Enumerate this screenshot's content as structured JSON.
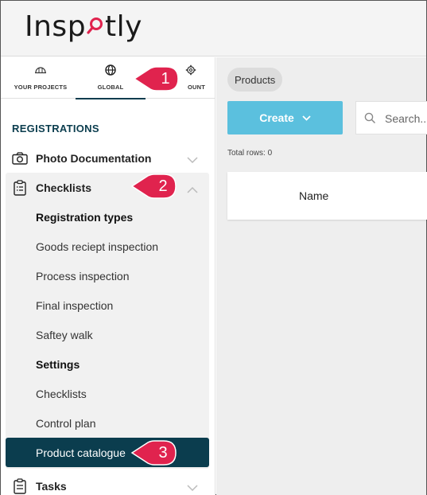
{
  "app": {
    "logo_text_left": "Insp",
    "logo_text_right": "tly",
    "brand_color": "#e0234e"
  },
  "sidebar": {
    "tabs": [
      {
        "label": "YOUR PROJECTS",
        "icon": "hard-hat-icon"
      },
      {
        "label": "GLOBAL",
        "icon": "globe-icon",
        "active": true
      },
      {
        "label": "OUNT",
        "icon": "gear-icon"
      }
    ],
    "section_title": "REGISTRATIONS",
    "items": [
      {
        "label": "Photo Documentation",
        "icon": "camera-icon",
        "expanded": false
      },
      {
        "label": "Checklists",
        "icon": "clipboard-icon",
        "expanded": true
      },
      {
        "label": "Tasks",
        "icon": "clipboard-icon",
        "expanded": false
      }
    ],
    "sub_items": [
      {
        "label": "Registration types",
        "heading": true
      },
      {
        "label": "Goods reciept inspection"
      },
      {
        "label": "Process inspection"
      },
      {
        "label": "Final inspection"
      },
      {
        "label": "Saftey walk"
      },
      {
        "label": "Settings",
        "heading": true
      },
      {
        "label": "Checklists"
      },
      {
        "label": "Control plan"
      },
      {
        "label": "Product catalogue",
        "active": true
      }
    ]
  },
  "main": {
    "breadcrumb": "Products",
    "create_label": "Create",
    "search_placeholder": "Search...",
    "total_rows": "Total rows: 0",
    "table_columns": [
      "Name"
    ]
  },
  "callouts": [
    "1",
    "2",
    "3"
  ],
  "colors": {
    "accent": "#5bc0de",
    "nav_active": "#0b3d4e",
    "callout": "#e0234e"
  }
}
